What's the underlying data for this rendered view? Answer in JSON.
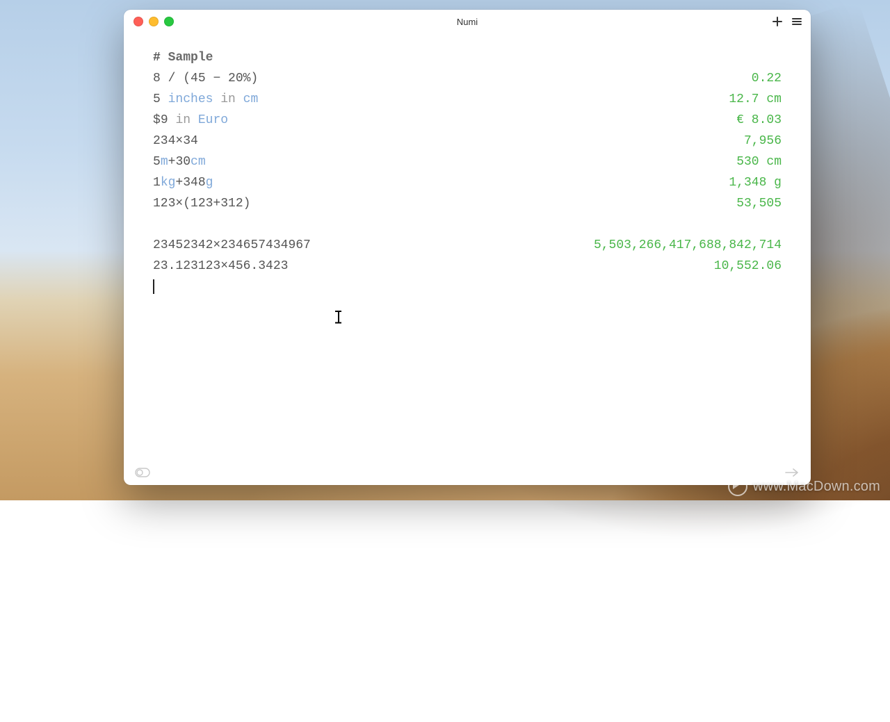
{
  "window": {
    "title": "Numi"
  },
  "lines": [
    {
      "type": "heading",
      "tokens": [
        {
          "t": "op",
          "v": "# "
        },
        {
          "t": "head",
          "v": "Sample"
        }
      ],
      "result": ""
    },
    {
      "type": "calc",
      "tokens": [
        {
          "t": "num",
          "v": "8"
        },
        {
          "t": "op",
          "v": " / ("
        },
        {
          "t": "num",
          "v": "45"
        },
        {
          "t": "op",
          "v": " − "
        },
        {
          "t": "num",
          "v": "20%"
        },
        {
          "t": "op",
          "v": ")"
        }
      ],
      "result": "0.22"
    },
    {
      "type": "calc",
      "tokens": [
        {
          "t": "num",
          "v": "5"
        },
        {
          "t": "op",
          "v": " "
        },
        {
          "t": "unit",
          "v": "inches"
        },
        {
          "t": "op",
          "v": " "
        },
        {
          "t": "word",
          "v": "in"
        },
        {
          "t": "op",
          "v": " "
        },
        {
          "t": "unit",
          "v": "cm"
        }
      ],
      "result": "12.7 cm"
    },
    {
      "type": "calc",
      "tokens": [
        {
          "t": "op",
          "v": "$"
        },
        {
          "t": "num",
          "v": "9"
        },
        {
          "t": "op",
          "v": " "
        },
        {
          "t": "word",
          "v": "in"
        },
        {
          "t": "op",
          "v": " "
        },
        {
          "t": "cur",
          "v": "Euro"
        }
      ],
      "result": "€ 8.03"
    },
    {
      "type": "calc",
      "tokens": [
        {
          "t": "num",
          "v": "234"
        },
        {
          "t": "op",
          "v": "×"
        },
        {
          "t": "num",
          "v": "34"
        }
      ],
      "result": "7,956"
    },
    {
      "type": "calc",
      "tokens": [
        {
          "t": "num",
          "v": "5"
        },
        {
          "t": "unit",
          "v": "m"
        },
        {
          "t": "op",
          "v": "+"
        },
        {
          "t": "num",
          "v": "30"
        },
        {
          "t": "unit",
          "v": "cm"
        }
      ],
      "result": "530 cm"
    },
    {
      "type": "calc",
      "tokens": [
        {
          "t": "num",
          "v": "1"
        },
        {
          "t": "unit",
          "v": "kg"
        },
        {
          "t": "op",
          "v": "+"
        },
        {
          "t": "num",
          "v": "348"
        },
        {
          "t": "unit",
          "v": "g"
        }
      ],
      "result": "1,348 g"
    },
    {
      "type": "calc",
      "tokens": [
        {
          "t": "num",
          "v": "123"
        },
        {
          "t": "op",
          "v": "×("
        },
        {
          "t": "num",
          "v": "123"
        },
        {
          "t": "op",
          "v": "+"
        },
        {
          "t": "num",
          "v": "312"
        },
        {
          "t": "op",
          "v": ")"
        }
      ],
      "result": "53,505"
    },
    {
      "type": "blank"
    },
    {
      "type": "calc",
      "tokens": [
        {
          "t": "num",
          "v": "23452342"
        },
        {
          "t": "op",
          "v": "×"
        },
        {
          "t": "num",
          "v": "234657434967"
        }
      ],
      "result": "5,503,266,417,688,842,714"
    },
    {
      "type": "calc",
      "tokens": [
        {
          "t": "num",
          "v": "23.123123"
        },
        {
          "t": "op",
          "v": "×"
        },
        {
          "t": "num",
          "v": "456.3423"
        }
      ],
      "result": "10,552.06"
    },
    {
      "type": "cursor"
    }
  ],
  "watermark": "www.MacDown.com"
}
